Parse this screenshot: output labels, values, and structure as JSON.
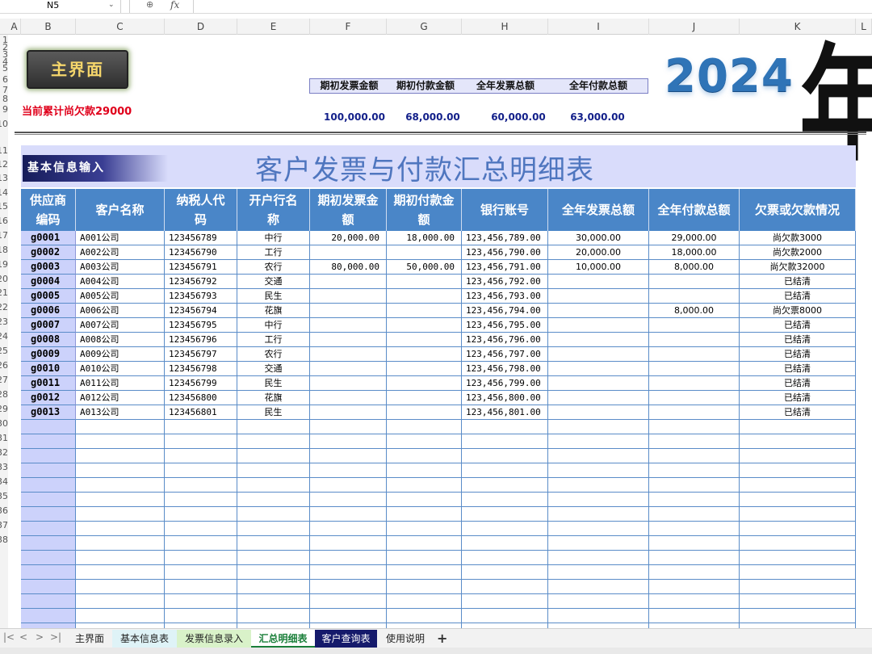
{
  "formula_bar": {
    "cell_ref": "N5",
    "dropdown": "⌄",
    "zoom_icon": "magnifier-icon",
    "zoom_glyph": "⊕",
    "fx_label": "fx"
  },
  "columns": [
    "A",
    "B",
    "C",
    "D",
    "E",
    "F",
    "G",
    "H",
    "I",
    "J",
    "K",
    "L"
  ],
  "row_numbers": [
    "1",
    "2",
    "3",
    "4",
    "5",
    "6",
    "7",
    "8",
    "9",
    "10",
    "11",
    "12",
    "13",
    "14",
    "15",
    "16",
    "17",
    "18",
    "19",
    "20",
    "21",
    "22",
    "23",
    "24",
    "25",
    "26",
    "27",
    "28",
    "29",
    "30",
    "31",
    "32",
    "33",
    "34",
    "35",
    "36",
    "37",
    "38"
  ],
  "banner": {
    "main_button": "主界面",
    "debt_note": "当前累计尚欠款29000",
    "summary_headers": [
      "期初发票金额",
      "期初付款金额",
      "全年发票总额",
      "全年付款总额"
    ],
    "summary_values": [
      "100,000.00",
      "68,000.00",
      "60,000.00",
      "63,000.00"
    ],
    "year": "2024",
    "year_glyph": "年"
  },
  "title_row": {
    "basic_button": "基本信息输入",
    "title": "客户发票与付款汇总明细表"
  },
  "table": {
    "headers": [
      "供应商编码",
      "客户名称",
      "纳税人代码",
      "开户行名称",
      "期初发票金额",
      "期初付款金额",
      "银行账号",
      "全年发票总额",
      "全年付款总额",
      "欠票或欠款情况"
    ],
    "rows": [
      [
        "g0001",
        "A001公司",
        "123456789",
        "中行",
        "20,000.00",
        "18,000.00",
        "123,456,789.00",
        "30,000.00",
        "29,000.00",
        "尚欠款3000"
      ],
      [
        "g0002",
        "A002公司",
        "123456790",
        "工行",
        "",
        "",
        "123,456,790.00",
        "20,000.00",
        "18,000.00",
        "尚欠款2000"
      ],
      [
        "g0003",
        "A003公司",
        "123456791",
        "农行",
        "80,000.00",
        "50,000.00",
        "123,456,791.00",
        "10,000.00",
        "8,000.00",
        "尚欠款32000"
      ],
      [
        "g0004",
        "A004公司",
        "123456792",
        "交通",
        "",
        "",
        "123,456,792.00",
        "",
        "",
        "已结清"
      ],
      [
        "g0005",
        "A005公司",
        "123456793",
        "民生",
        "",
        "",
        "123,456,793.00",
        "",
        "",
        "已结清"
      ],
      [
        "g0006",
        "A006公司",
        "123456794",
        "花旗",
        "",
        "",
        "123,456,794.00",
        "",
        "8,000.00",
        "尚欠票8000"
      ],
      [
        "g0007",
        "A007公司",
        "123456795",
        "中行",
        "",
        "",
        "123,456,795.00",
        "",
        "",
        "已结清"
      ],
      [
        "g0008",
        "A008公司",
        "123456796",
        "工行",
        "",
        "",
        "123,456,796.00",
        "",
        "",
        "已结清"
      ],
      [
        "g0009",
        "A009公司",
        "123456797",
        "农行",
        "",
        "",
        "123,456,797.00",
        "",
        "",
        "已结清"
      ],
      [
        "g0010",
        "A010公司",
        "123456798",
        "交通",
        "",
        "",
        "123,456,798.00",
        "",
        "",
        "已结清"
      ],
      [
        "g0011",
        "A011公司",
        "123456799",
        "民生",
        "",
        "",
        "123,456,799.00",
        "",
        "",
        "已结清"
      ],
      [
        "g0012",
        "A012公司",
        "123456800",
        "花旗",
        "",
        "",
        "123,456,800.00",
        "",
        "",
        "已结清"
      ],
      [
        "g0013",
        "A013公司",
        "123456801",
        "民生",
        "",
        "",
        "123,456,801.00",
        "",
        "",
        "已结清"
      ]
    ],
    "empty_rows": 15
  },
  "sheet_tabs": {
    "nav": [
      "|<",
      "<",
      ">",
      ">|"
    ],
    "tabs": [
      {
        "label": "主界面",
        "bg": "#f2f2f2",
        "color": "#222222",
        "active": false
      },
      {
        "label": "基本信息表",
        "bg": "#dff3f7",
        "color": "#222222",
        "active": false
      },
      {
        "label": "发票信息录入",
        "bg": "#d9f2c9",
        "color": "#222222",
        "active": false
      },
      {
        "label": "汇总明细表",
        "bg": "#ffffff",
        "color": "#1a7f3a",
        "active": true
      },
      {
        "label": "客户查询表",
        "bg": "#151a6b",
        "color": "#ffffff",
        "active": false
      },
      {
        "label": "使用说明",
        "bg": "#f2f2f2",
        "color": "#222222",
        "active": false
      }
    ],
    "add": "+"
  }
}
